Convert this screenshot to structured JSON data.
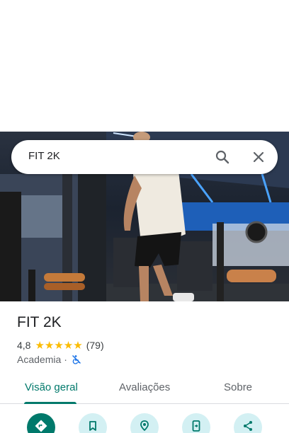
{
  "search": {
    "query": "FIT 2K"
  },
  "place": {
    "name": "FIT 2K",
    "rating": "4,8",
    "stars": "★★★★★",
    "review_count": "(79)",
    "category": "Academia",
    "separator": "·"
  },
  "tabs": [
    {
      "label": "Visão geral",
      "active": true
    },
    {
      "label": "Avaliações",
      "active": false
    },
    {
      "label": "Sobre",
      "active": false
    }
  ],
  "actions": [
    {
      "icon": "directions-icon"
    },
    {
      "icon": "save-icon"
    },
    {
      "icon": "nearby-icon"
    },
    {
      "icon": "send-to-phone-icon"
    },
    {
      "icon": "share-icon"
    }
  ],
  "colors": {
    "accent": "#00796b",
    "star": "#fbbc04",
    "action_bg": "#d3f0f3"
  }
}
